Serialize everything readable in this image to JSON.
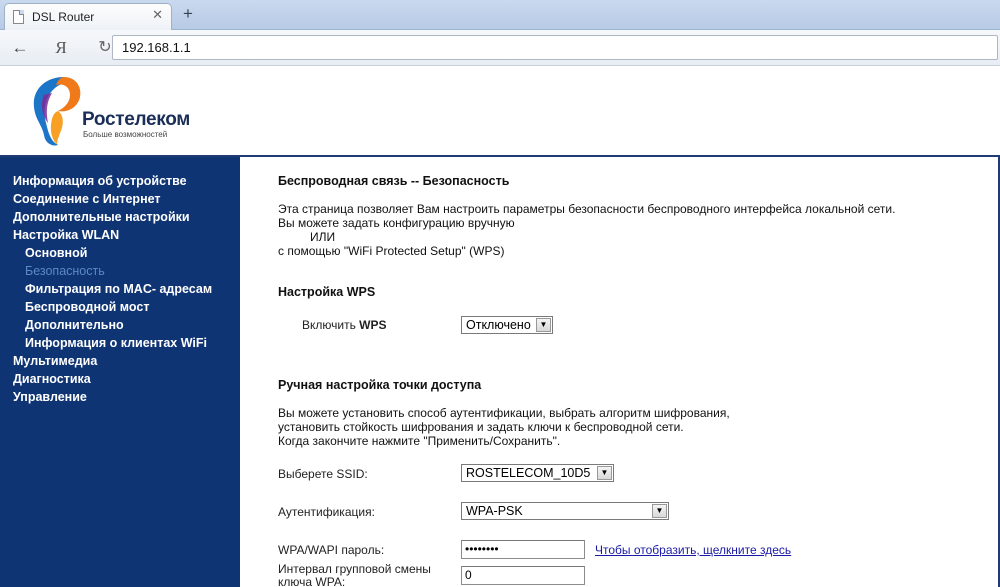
{
  "browser": {
    "tab_title": "DSL Router",
    "tab_close": "✕",
    "new_tab": "+",
    "back": "←",
    "yandex": "Я",
    "reload": "↻",
    "url": "192.168.1.1"
  },
  "header": {
    "brand": "Ростелеком",
    "slogan": "Больше возможностей"
  },
  "sidebar": {
    "items": [
      {
        "label": "Информация об устройстве"
      },
      {
        "label": "Соединение с Интернет"
      },
      {
        "label": "Дополнительные настройки"
      },
      {
        "label": "Настройка WLAN"
      },
      {
        "label": "Основной"
      },
      {
        "label": "Безопасность"
      },
      {
        "label": "Фильтрация по MAC- адресам"
      },
      {
        "label": "Беспроводной мост"
      },
      {
        "label": "Дополнительно"
      },
      {
        "label": "Информация о клиентах WiFi"
      },
      {
        "label": "Мультимедиа"
      },
      {
        "label": "Диагностика"
      },
      {
        "label": "Управление"
      }
    ]
  },
  "main": {
    "title": "Беспроводная связь -- Безопасность",
    "intro_line1": "Эта страница позволяет Вам настроить параметры безопасности беспроводного интерфейса локальной сети.",
    "intro_line2": "Вы можете задать конфигурацию вручную",
    "intro_line3": "ИЛИ",
    "intro_line4": "с помощью \"WiFi Protected Setup\" (WPS)",
    "wps_title": "Настройка WPS",
    "wps_label_prefix": "Включить ",
    "wps_label_bold": "WPS",
    "wps_value": "Отключено",
    "manual_title": "Ручная настройка точки доступа",
    "manual_line1": "Вы можете установить способ аутентификации, выбрать алгоритм шифрования,",
    "manual_line2": "установить стойкость шифрования и задать ключи к беспроводной сети.",
    "manual_line3": "Когда закончите нажмите \"Применить/Сохранить\".",
    "ssid_label": "Выберете SSID:",
    "ssid_value": "ROSTELECOM_10D5",
    "auth_label": "Аутентификация:",
    "auth_value": "WPA-PSK",
    "password_label": "WPA/WAPI пароль:",
    "password_value": "••••••••",
    "show_link": "Чтобы отобразить, щелкните здесь",
    "interval_label_line1": "Интервал групповой смены",
    "interval_label_line2": "ключа WPA:",
    "interval_value": "0",
    "arrow": "▼"
  },
  "colors": {
    "sidebar_bg": "#0f3474",
    "active_item": "#5c88c8",
    "link": "#1a1aa6"
  }
}
